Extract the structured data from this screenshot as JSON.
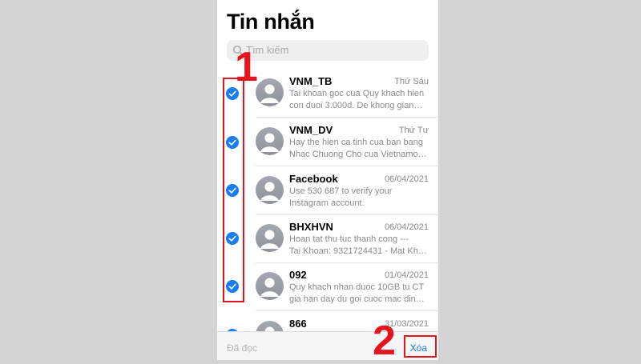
{
  "header": {
    "title": "Tin nhắn"
  },
  "search": {
    "placeholder": "Tìm kiếm"
  },
  "messages": [
    {
      "name": "VNM_TB",
      "date": "Thứ Sáu",
      "preview": "Tai khoan goc cua Quy khach hien\ncon duoi 3.000d. De khong gian…",
      "selected": true
    },
    {
      "name": "VNM_DV",
      "date": "Thứ Tư",
      "preview": "Hay the hien ca tinh cua ban bang\nNhac Chuong Cho cua Vietnamo…",
      "selected": true
    },
    {
      "name": "Facebook",
      "date": "06/04/2021",
      "preview": "Use 530 687 to verify your\nInstagram account.",
      "selected": true
    },
    {
      "name": "BHXHVN",
      "date": "06/04/2021",
      "preview": "Hoan tat thu tuc thanh cong ---\nTai Khoan: 9321724431 - Mat Kh…",
      "selected": true
    },
    {
      "name": "092",
      "date": "01/04/2021",
      "preview": "Quy khach nhan duoc 10GB tu CT\ngia han day du goi cuoc mac din…",
      "selected": true
    },
    {
      "name": "866",
      "date": "31/03/2021",
      "preview": "",
      "selected": true
    }
  ],
  "toolbar": {
    "mark_read_label": "Đã đọc",
    "delete_label": "Xóa"
  },
  "annotations": {
    "step1": "1",
    "step2": "2"
  },
  "colors": {
    "accent": "#1a7cf0",
    "annotation": "#e5151d"
  }
}
